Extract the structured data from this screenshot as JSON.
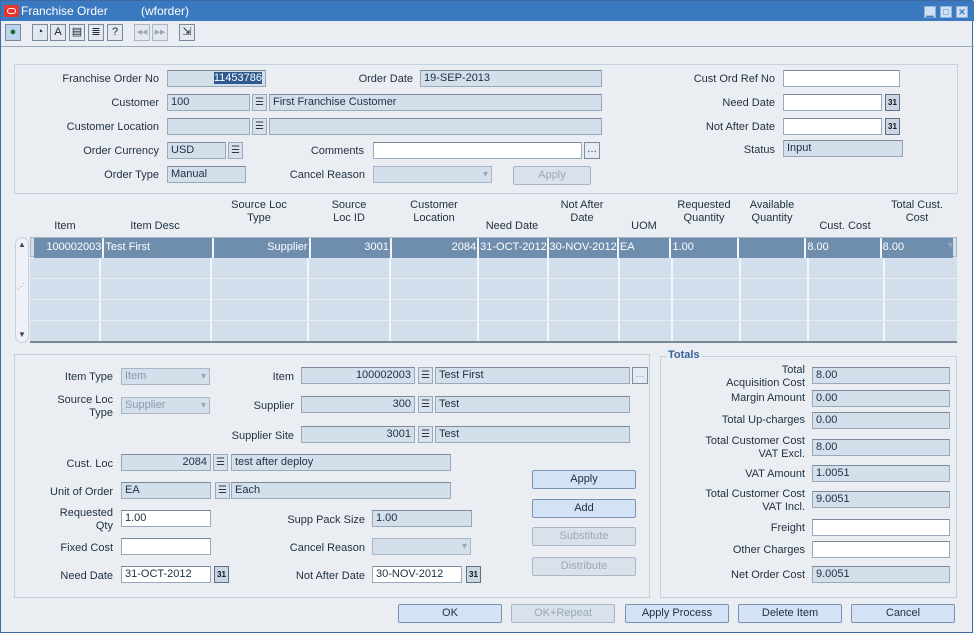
{
  "window": {
    "title": "Franchise Order",
    "form_name": "(wforder)",
    "controls": {
      "minimize": "▁",
      "maximize": "□",
      "close": "✕"
    }
  },
  "toolbar": {
    "icons": [
      {
        "name": "globe-icon",
        "glyph": "●"
      },
      {
        "name": "calculator-icon",
        "glyph": "◔"
      },
      {
        "name": "spell-check-icon",
        "glyph": "A"
      },
      {
        "name": "form-info-icon",
        "glyph": "▤"
      },
      {
        "name": "print-icon",
        "glyph": "≣"
      },
      {
        "name": "help-icon",
        "glyph": "?"
      },
      {
        "name": "previous-record-icon",
        "glyph": "◀◀"
      },
      {
        "name": "next-record-icon",
        "glyph": "▶▶"
      },
      {
        "name": "exit-icon",
        "glyph": "⇲"
      }
    ]
  },
  "header": {
    "franchise_order_no": {
      "label": "Franchise Order No",
      "value": "11453786"
    },
    "order_date": {
      "label": "Order Date",
      "value": "19-SEP-2013"
    },
    "cust_ord_ref_no": {
      "label": "Cust Ord Ref No",
      "value": ""
    },
    "customer": {
      "label": "Customer",
      "value": "100",
      "desc": "First Franchise Customer"
    },
    "need_date": {
      "label": "Need Date",
      "value": ""
    },
    "customer_location": {
      "label": "Customer Location",
      "value": "",
      "desc": ""
    },
    "not_after_date": {
      "label": "Not After Date",
      "value": ""
    },
    "order_currency": {
      "label": "Order Currency",
      "value": "USD"
    },
    "comments": {
      "label": "Comments",
      "value": ""
    },
    "status": {
      "label": "Status",
      "value": "Input"
    },
    "order_type": {
      "label": "Order Type",
      "value": "Manual"
    },
    "cancel_reason": {
      "label": "Cancel Reason",
      "value": ""
    },
    "apply_label": "Apply"
  },
  "grid": {
    "columns": [
      "Item",
      "Item Desc",
      "Source Loc\nType",
      "Source\nLoc ID",
      "Customer\nLocation",
      "Need Date",
      "Not After\nDate",
      "UOM",
      "Requested\nQuantity",
      "Available\nQuantity",
      "Cust. Cost",
      "Total Cust.\nCost"
    ],
    "rows": [
      [
        "100002003",
        "Test First",
        "Supplier",
        "3001",
        "2084",
        "31-OCT-2012",
        "30-NOV-2012",
        "EA",
        "1.00",
        "",
        "8.00",
        "8.00"
      ],
      [
        "",
        "",
        "",
        "",
        "",
        "",
        "",
        "",
        "",
        "",
        "",
        ""
      ],
      [
        "",
        "",
        "",
        "",
        "",
        "",
        "",
        "",
        "",
        "",
        "",
        ""
      ],
      [
        "",
        "",
        "",
        "",
        "",
        "",
        "",
        "",
        "",
        "",
        "",
        ""
      ],
      [
        "",
        "",
        "",
        "",
        "",
        "",
        "",
        "",
        "",
        "",
        "",
        ""
      ]
    ]
  },
  "detail": {
    "item_type": {
      "label": "Item Type",
      "value": "Item"
    },
    "source_loc_type": {
      "label": "Source Loc Type",
      "value": "Supplier"
    },
    "item": {
      "label": "Item",
      "value": "100002003",
      "desc": "Test First"
    },
    "supplier": {
      "label": "Supplier",
      "value": "300",
      "desc": "Test"
    },
    "supplier_site": {
      "label": "Supplier Site",
      "value": "3001",
      "desc": "Test"
    },
    "cust_loc": {
      "label": "Cust. Loc",
      "value": "2084",
      "desc": "test after deploy"
    },
    "unit_of_order": {
      "label": "Unit of Order",
      "value": "EA",
      "desc": "Each"
    },
    "requested_qty": {
      "label": "Requested Qty",
      "value": "1.00"
    },
    "supp_pack_size": {
      "label": "Supp Pack Size",
      "value": "1.00"
    },
    "fixed_cost": {
      "label": "Fixed Cost",
      "value": ""
    },
    "cancel_reason": {
      "label": "Cancel Reason",
      "value": ""
    },
    "need_date": {
      "label": "Need Date",
      "value": "31-OCT-2012"
    },
    "not_after_date": {
      "label": "Not After Date",
      "value": "30-NOV-2012"
    },
    "buttons": {
      "apply": "Apply",
      "add": "Add",
      "substitute": "Substitute",
      "distribute": "Distribute"
    }
  },
  "totals": {
    "title": "Totals",
    "total_acquisition_cost": {
      "label": "Total Acquisition Cost",
      "value": "8.00"
    },
    "margin_amount": {
      "label": "Margin Amount",
      "value": "0.00"
    },
    "total_upcharges": {
      "label": "Total Up-charges",
      "value": "0.00"
    },
    "total_cust_cost_excl": {
      "label": "Total Customer Cost VAT Excl.",
      "value": "8.00"
    },
    "vat_amount": {
      "label": "VAT Amount",
      "value": "1.0051"
    },
    "total_cust_cost_incl": {
      "label": "Total Customer Cost VAT Incl.",
      "value": "9.0051"
    },
    "freight": {
      "label": "Freight",
      "value": ""
    },
    "other_charges": {
      "label": "Other Charges",
      "value": ""
    },
    "net_order_cost": {
      "label": "Net Order Cost",
      "value": "9.0051"
    }
  },
  "footer": {
    "ok": "OK",
    "ok_repeat": "OK+Repeat",
    "apply_process": "Apply Process",
    "delete_item": "Delete Item",
    "cancel": "Cancel"
  }
}
